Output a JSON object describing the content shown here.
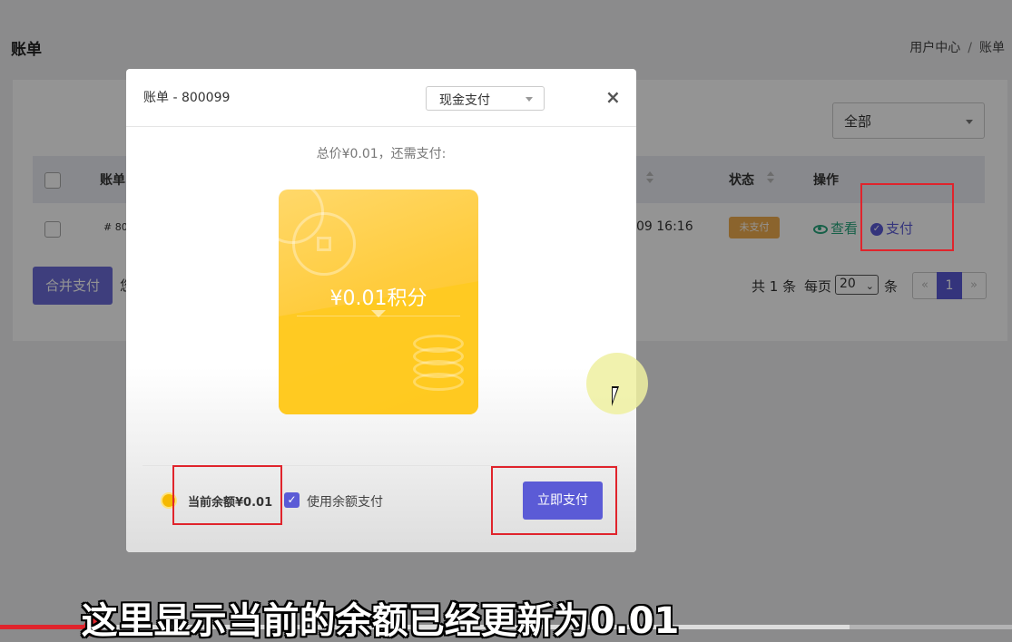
{
  "page": {
    "title": "账单",
    "breadcrumb": [
      "用户中心",
      "/",
      "账单"
    ]
  },
  "filter": {
    "selected": "全部"
  },
  "table": {
    "headers": {
      "bill": "账单",
      "status": "状态",
      "actions": "操作"
    },
    "row": {
      "bill_no": "# 800",
      "time": "09 16:16",
      "status": "未支付",
      "view_label": "查看",
      "pay_label": "支付"
    }
  },
  "bulk": {
    "merge_pay_label": "合并支付",
    "partial_text": "您"
  },
  "pagination": {
    "total_text": "共 1 条",
    "per_page_label": "每页",
    "per_page_value": "20",
    "items_label": "条",
    "prev": "«",
    "current": "1",
    "next": "»"
  },
  "modal": {
    "title": "账单 - 800099",
    "payment_method": "现金支付",
    "close": "×",
    "price_line": "总价¥0.01，还需支付:",
    "card_amount": "¥0.01积分",
    "balance_label": "当前余额¥0.01",
    "use_balance_checked": true,
    "use_balance_label": "使用余额支付",
    "pay_now_label": "立即支付"
  },
  "video": {
    "subtitle": "这里显示当前的余额已经更新为0.01",
    "progress": 0.092
  },
  "colors": {
    "accent": "#5b5bd6",
    "success": "#27a57c",
    "warning": "#f0ad4e",
    "highlight_box": "#e0242c"
  }
}
